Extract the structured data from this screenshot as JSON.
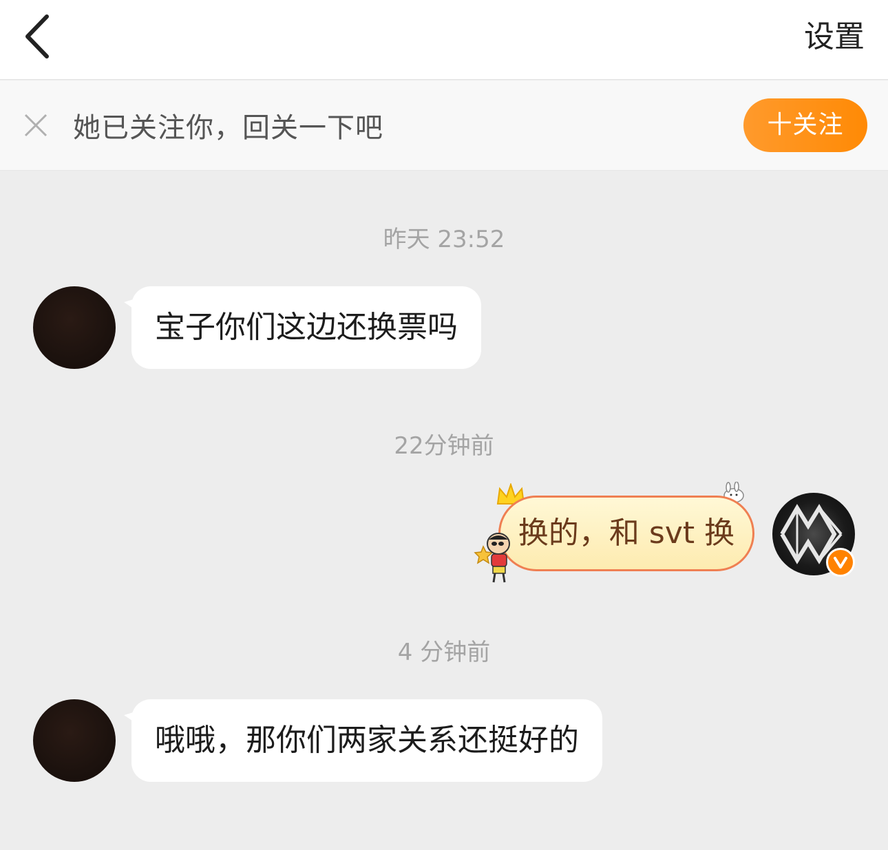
{
  "nav": {
    "back_icon": "chevron-left-icon",
    "settings_label": "设置"
  },
  "follow_banner": {
    "text": "她已关注你，回关一下吧",
    "button_label": "十关注",
    "dismiss_icon": "close-icon",
    "button_color": "#ff8a05"
  },
  "messages": [
    {
      "timestamp": "昨天 23:52",
      "direction": "incoming",
      "text": "宝子你们这边还换票吗"
    },
    {
      "timestamp": "22分钟前",
      "direction": "outgoing",
      "text": "换的，和 svt 换"
    },
    {
      "timestamp": "4 分钟前",
      "direction": "incoming",
      "text": "哦哦，那你们两家关系还挺好的"
    }
  ],
  "colors": {
    "background": "#ededed",
    "bubble_in": "#ffffff",
    "bubble_out_border": "#ef7f52",
    "verified_badge": "#ff8200"
  }
}
